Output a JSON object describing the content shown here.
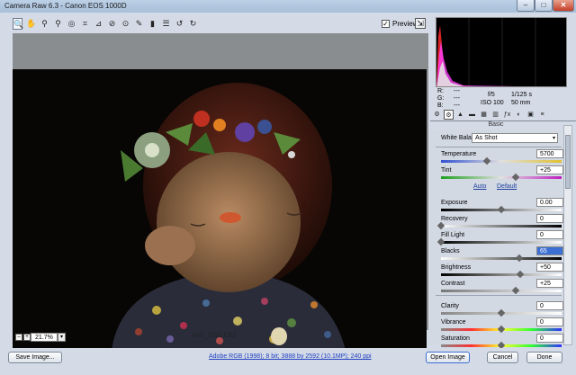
{
  "window": {
    "title": "Camera Raw 6.3  -  Canon EOS 1000D",
    "controls": [
      "–",
      "□",
      "✕"
    ]
  },
  "toolbar": {
    "tools": [
      {
        "name": "zoom-tool-icon",
        "glyph": "🔍",
        "selected": true
      },
      {
        "name": "hand-tool-icon",
        "glyph": "✋",
        "selected": false
      },
      {
        "name": "white-balance-tool-icon",
        "glyph": "⚲",
        "selected": false
      },
      {
        "name": "color-sampler-tool-icon",
        "glyph": "⚲",
        "selected": false
      },
      {
        "name": "target-adjustment-tool-icon",
        "glyph": "◎",
        "selected": false
      },
      {
        "name": "crop-tool-icon",
        "glyph": "⌗",
        "selected": false
      },
      {
        "name": "straighten-tool-icon",
        "glyph": "⊿",
        "selected": false
      },
      {
        "name": "spot-removal-tool-icon",
        "glyph": "⊘",
        "selected": false
      },
      {
        "name": "red-eye-tool-icon",
        "glyph": "⊙",
        "selected": false
      },
      {
        "name": "adjustment-brush-icon",
        "glyph": "✎",
        "selected": false
      },
      {
        "name": "graduated-filter-icon",
        "glyph": "▮",
        "selected": false
      },
      {
        "name": "preferences-icon",
        "glyph": "☰",
        "selected": false
      },
      {
        "name": "rotate-ccw-icon",
        "glyph": "↺",
        "selected": false
      },
      {
        "name": "rotate-cw-icon",
        "glyph": "↻",
        "selected": false
      }
    ],
    "preview_label": "Preview",
    "preview_checked": "✓",
    "fullscreen_glyph": "⇲"
  },
  "status": {
    "zoom": "21.7%",
    "zoom_arrow": "▾",
    "filename": "IMG_5316.CR2",
    "minus": "–",
    "plus": "+"
  },
  "camera_info": {
    "r": "R:",
    "g": "G:",
    "b": "B:",
    "dash": "---",
    "aperture": "f/5",
    "shutter": "1/125 s",
    "iso": "ISO 100",
    "focal": "50 mm"
  },
  "panel_tabs": [
    "⚙",
    "⚙",
    "▲",
    "▬",
    "▦",
    "▥",
    "ƒx",
    "◐",
    "▣",
    "≡"
  ],
  "panel": {
    "title": "Basic",
    "wb_label": "White Balance:",
    "wb_value": "As Shot",
    "wb_arrow": "▾",
    "auto": "Auto",
    "default": "Default",
    "temperature": {
      "label": "Temperature",
      "value": "5700",
      "pos": 0.38
    },
    "tint": {
      "label": "Tint",
      "value": "+25",
      "pos": 0.62
    },
    "exposure": {
      "label": "Exposure",
      "value": "0.00",
      "pos": 0.5
    },
    "recovery": {
      "label": "Recovery",
      "value": "0",
      "pos": 0.0
    },
    "filllight": {
      "label": "Fill Light",
      "value": "0",
      "pos": 0.0
    },
    "blacks": {
      "label": "Blacks",
      "value": "65",
      "pos": 0.65
    },
    "brightness": {
      "label": "Brightness",
      "value": "+50",
      "pos": 0.66
    },
    "contrast": {
      "label": "Contrast",
      "value": "+25",
      "pos": 0.62
    },
    "clarity": {
      "label": "Clarity",
      "value": "0",
      "pos": 0.5
    },
    "vibrance": {
      "label": "Vibrance",
      "value": "0",
      "pos": 0.5
    },
    "saturation": {
      "label": "Saturation",
      "value": "0",
      "pos": 0.5
    }
  },
  "footer": {
    "save": "Save Image...",
    "info": "Adobe RGB (1998); 8 bit; 3888 by 2592 (10.1MP); 240 ppi",
    "open": "Open Image",
    "cancel": "Cancel",
    "done": "Done"
  },
  "colors": {
    "accent": "#3c6fd4",
    "link": "#2040c0"
  }
}
